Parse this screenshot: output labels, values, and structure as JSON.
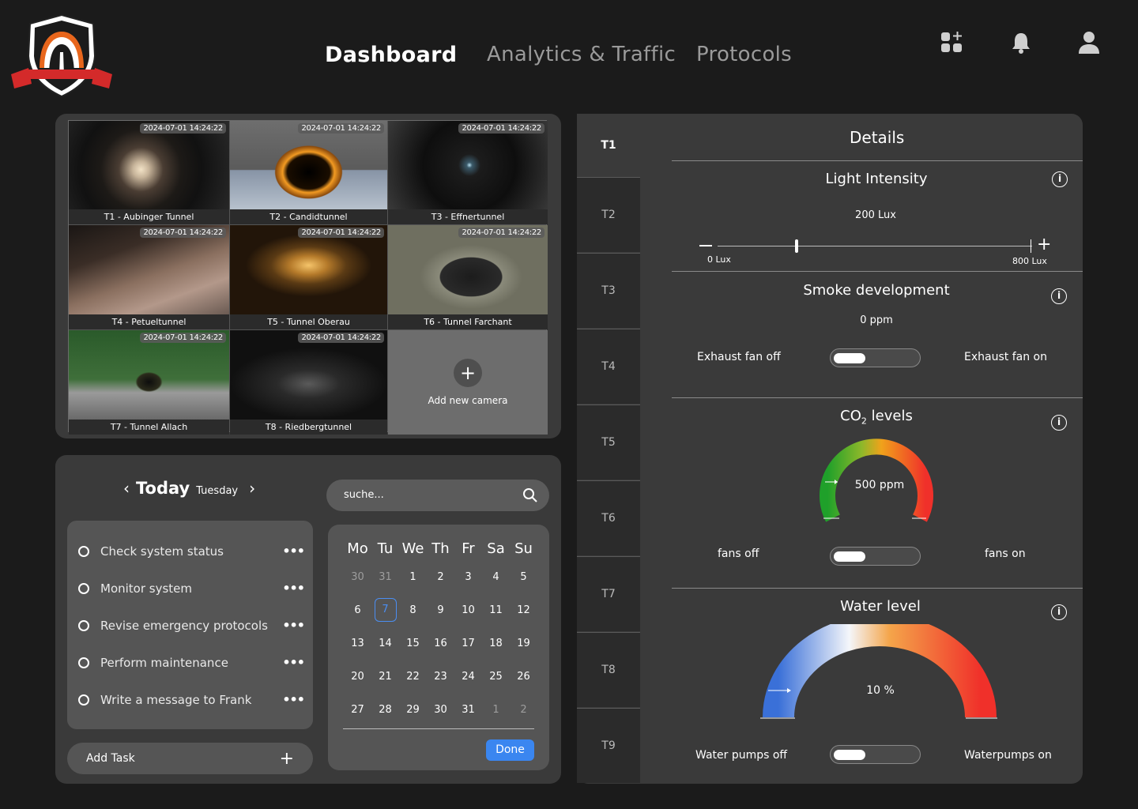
{
  "nav": {
    "dashboard": "Dashboard",
    "analytics": "Analytics & Traffic",
    "protocols": "Protocols"
  },
  "header_icons": [
    "add-widget-icon",
    "bell-icon",
    "user-icon"
  ],
  "cameras": [
    {
      "caption": "T1 - Aubinger Tunnel",
      "timestamp": "2024-07-01 14:24:22"
    },
    {
      "caption": "T2 - Candidtunnel",
      "timestamp": "2024-07-01 14:24:22"
    },
    {
      "caption": "T3 - Effnertunnel",
      "timestamp": "2024-07-01 14:24:22"
    },
    {
      "caption": "T4 - Petueltunnel",
      "timestamp": "2024-07-01 14:24:22"
    },
    {
      "caption": "T5 - Tunnel Oberau",
      "timestamp": "2024-07-01 14:24:22"
    },
    {
      "caption": "T6 - Tunnel Farchant",
      "timestamp": "2024-07-01 14:24:22"
    },
    {
      "caption": "T7 - Tunnel Allach",
      "timestamp": "2024-07-01 14:24:22"
    },
    {
      "caption": "T8 - Riedbergtunnel",
      "timestamp": "2024-07-01 14:24:22"
    }
  ],
  "add_camera": "Add new camera",
  "today": {
    "label": "Today",
    "weekday": "Tuesday"
  },
  "search": {
    "placeholder": "suche..."
  },
  "tasks": [
    "Check system status",
    "Monitor system",
    "Revise emergency protocols",
    "Perform maintenance",
    "Write a message to Frank"
  ],
  "task_menu": "•••",
  "add_task": "Add Task",
  "calendar": {
    "weekdays": [
      "Mo",
      "Tu",
      "We",
      "Th",
      "Fr",
      "Sa",
      "Su"
    ],
    "weeks": [
      [
        "30",
        "31",
        "1",
        "2",
        "3",
        "4",
        "5"
      ],
      [
        "6",
        "7",
        "8",
        "9",
        "10",
        "11",
        "12"
      ],
      [
        "13",
        "14",
        "15",
        "16",
        "17",
        "18",
        "19"
      ],
      [
        "20",
        "21",
        "22",
        "23",
        "24",
        "25",
        "26"
      ],
      [
        "27",
        "28",
        "29",
        "30",
        "31",
        "1",
        "2"
      ]
    ],
    "selected": "7",
    "done": "Done"
  },
  "tabs": [
    "T1",
    "T2",
    "T3",
    "T4",
    "T5",
    "T6",
    "T7",
    "T8",
    "T9"
  ],
  "details": {
    "title": "Details",
    "light": {
      "title": "Light Intensity",
      "value": "200 Lux",
      "min": "0 Lux",
      "max": "800 Lux",
      "level": 0.25
    },
    "smoke": {
      "title": "Smoke development",
      "value": "0 ppm",
      "off": "Exhaust fan off",
      "on": "Exhaust fan on"
    },
    "co2": {
      "title_main": "CO",
      "title_sub": "2",
      "title_rest": " levels",
      "value": "500 ppm",
      "off": "fans off",
      "on": "fans on"
    },
    "water": {
      "title": "Water level",
      "value": "10 %",
      "off": "Water pumps off",
      "on": "Waterpumps on"
    }
  },
  "colors": {
    "accent": "#3a86f0",
    "panel": "#3a3a3a",
    "background": "#1b1b1b"
  }
}
